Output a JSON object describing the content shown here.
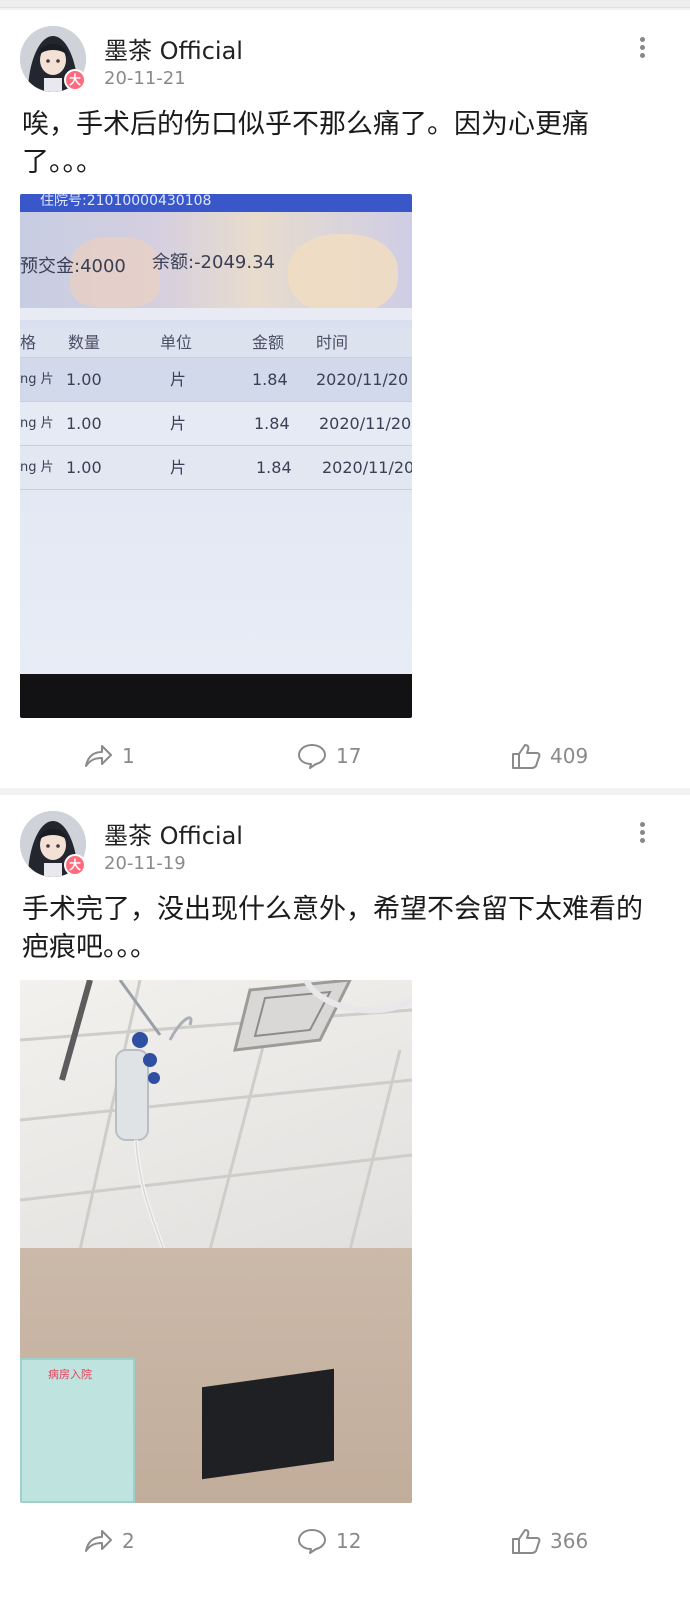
{
  "posts": [
    {
      "username": "墨茶 Official",
      "badge": "大",
      "date": "20-11-21",
      "text": "唉，手术后的伤口似乎不那么痛了。因为心更痛了。。。",
      "image": {
        "subject": "hospital billing screen",
        "top_strip": "住院号:21010000430108",
        "deposit": "预交金:4000",
        "balance": "余额:-2049.34",
        "columns": [
          "格",
          "数量",
          "单位",
          "金额",
          "时间"
        ],
        "rows": [
          [
            "ng 片",
            "1.00",
            "片",
            "1.84",
            "2020/11/20"
          ],
          [
            "ng 片",
            "1.00",
            "片",
            "1.84",
            "2020/11/20"
          ],
          [
            "ng 片",
            "1.00",
            "片",
            "1.84",
            "2020/11/20"
          ]
        ]
      },
      "actions": {
        "share_count": "1",
        "comment_count": "17",
        "like_count": "409"
      }
    },
    {
      "username": "墨茶 Official",
      "badge": "大",
      "date": "20-11-19",
      "text": "手术完了，没出现什么意外，希望不会留下太难看的疤痕吧。。。",
      "image": {
        "subject": "IV drip bag hanging from ceiling in hospital room",
        "poster_title": "病房入院"
      },
      "actions": {
        "share_count": "2",
        "comment_count": "12",
        "like_count": "366"
      }
    }
  ],
  "colors": {
    "background": "#f2f2f2",
    "card": "#ffffff",
    "text_primary": "#222222",
    "text_secondary": "#8a8a8a",
    "badge": "#ff6a7d"
  }
}
